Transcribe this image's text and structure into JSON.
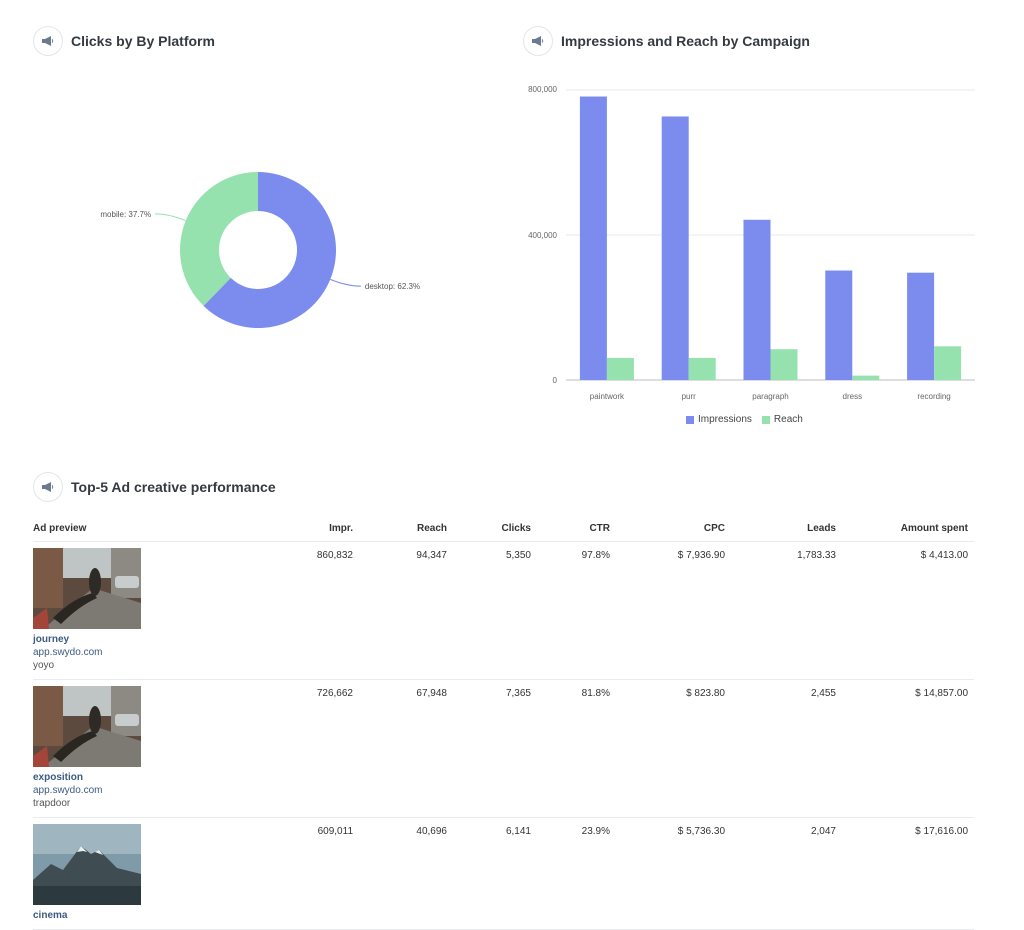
{
  "sections": {
    "platform_title": "Clicks by By Platform",
    "campaign_title": "Impressions and Reach by Campaign",
    "ads_title": "Top-5 Ad creative performance"
  },
  "colors": {
    "desktop": "#7b8bee",
    "mobile": "#95e2ae",
    "impressions": "#7b8bee",
    "reach": "#95e2ae"
  },
  "chart_data": [
    {
      "type": "pie",
      "variant": "donut",
      "title": "Clicks by By Platform",
      "slices": [
        {
          "label": "desktop",
          "value": 62.3,
          "text": "desktop: 62.3%"
        },
        {
          "label": "mobile",
          "value": 37.7,
          "text": "mobile: 37.7%"
        }
      ]
    },
    {
      "type": "bar",
      "title": "Impressions and Reach by Campaign",
      "categories": [
        "paintwork",
        "purr",
        "paragraph",
        "dress",
        "recording"
      ],
      "series": [
        {
          "name": "Impressions",
          "values": [
            782000,
            727000,
            442000,
            302000,
            296000
          ]
        },
        {
          "name": "Reach",
          "values": [
            61000,
            61000,
            85000,
            12000,
            93000
          ]
        }
      ],
      "ylim": [
        0,
        800000
      ],
      "yticks": [
        "0",
        "400,000",
        "800,000"
      ],
      "grid": true,
      "legend": "bottom-center"
    }
  ],
  "ads_table": {
    "headers": [
      "Ad preview",
      "Impr.",
      "Reach",
      "Clicks",
      "CTR",
      "CPC",
      "Leads",
      "Amount spent"
    ],
    "rows": [
      {
        "title": "journey",
        "domain": "app.swydo.com",
        "sub": "yoyo",
        "thumb": "street",
        "cells": [
          "860,832",
          "94,347",
          "5,350",
          "97.8%",
          "$ 7,936.90",
          "1,783.33",
          "$ 4,413.00"
        ]
      },
      {
        "title": "exposition",
        "domain": "app.swydo.com",
        "sub": "trapdoor",
        "thumb": "street",
        "cells": [
          "726,662",
          "67,948",
          "7,365",
          "81.8%",
          "$ 823.80",
          "2,455",
          "$ 14,857.00"
        ]
      },
      {
        "title": "cinema",
        "domain": "",
        "sub": "",
        "thumb": "mountain",
        "cells": [
          "609,011",
          "40,696",
          "6,141",
          "23.9%",
          "$ 5,736.30",
          "2,047",
          "$ 17,616.00"
        ]
      }
    ]
  }
}
